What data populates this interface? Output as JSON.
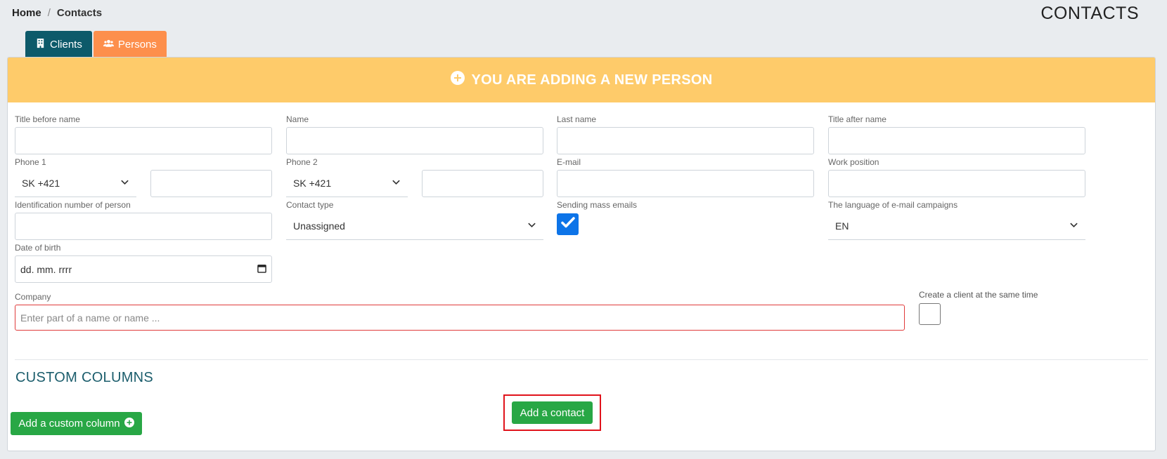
{
  "breadcrumb": {
    "home": "Home",
    "separator": "/",
    "current": "Contacts"
  },
  "page_title": "CONTACTS",
  "tabs": [
    {
      "label": "Clients",
      "icon": "building-icon",
      "color": "#0d5a6a"
    },
    {
      "label": "Persons",
      "icon": "users-icon",
      "color": "#fd8f4c"
    }
  ],
  "banner": {
    "text": "YOU ARE ADDING A NEW PERSON",
    "icon": "plus-circle-icon",
    "color": "#fecb6a"
  },
  "form": {
    "title_before": {
      "label": "Title before name",
      "value": ""
    },
    "name": {
      "label": "Name",
      "value": ""
    },
    "last_name": {
      "label": "Last name",
      "value": ""
    },
    "title_after": {
      "label": "Title after name",
      "value": ""
    },
    "phone1": {
      "label": "Phone 1",
      "prefix": "SK +421",
      "value": ""
    },
    "phone2": {
      "label": "Phone 2",
      "prefix": "SK +421",
      "value": ""
    },
    "email": {
      "label": "E-mail",
      "value": ""
    },
    "work_position": {
      "label": "Work position",
      "value": ""
    },
    "id_number": {
      "label": "Identification number of person",
      "value": ""
    },
    "contact_type": {
      "label": "Contact type",
      "value": "Unassigned"
    },
    "mass_emails": {
      "label": "Sending mass emails",
      "checked": true
    },
    "campaign_language": {
      "label": "The language of e-mail campaigns",
      "value": "EN"
    },
    "date_of_birth": {
      "label": "Date of birth",
      "placeholder": "dd. mm. rrrr"
    },
    "company": {
      "label": "Company",
      "placeholder": "Enter part of a name or name ..."
    },
    "create_client": {
      "label": "Create a client at the same time",
      "checked": false
    }
  },
  "custom_columns": {
    "title": "CUSTOM COLUMNS",
    "add_button": "Add a custom column"
  },
  "submit": {
    "label": "Add a contact"
  },
  "colors": {
    "accent_green": "#28a745",
    "checkbox_blue": "#0d74e8",
    "error_red": "#e03b3b"
  }
}
